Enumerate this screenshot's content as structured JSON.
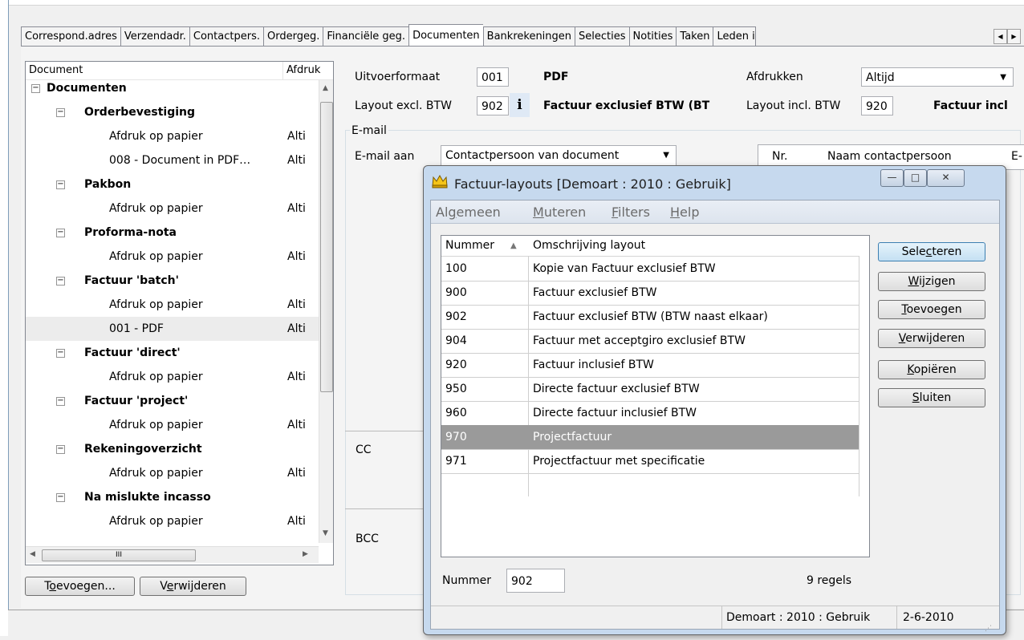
{
  "tabs": [
    "Correspond.adres",
    "Verzendadr.",
    "Contactpers.",
    "Ordergeg.",
    "Financiële geg.",
    "Documenten",
    "Bankrekeningen",
    "Selecties",
    "Notities",
    "Taken",
    "Leden ink"
  ],
  "tree": {
    "col_document": "Document",
    "col_afdruk": "Afdruk",
    "rows": [
      {
        "label": "Documenten",
        "afd": ""
      },
      {
        "label": "Orderbevestiging",
        "afd": ""
      },
      {
        "label": "Afdruk op papier",
        "afd": "Alti"
      },
      {
        "label": "008 - Document in PDF…",
        "afd": "Alti"
      },
      {
        "label": "Pakbon",
        "afd": ""
      },
      {
        "label": "Afdruk op papier",
        "afd": "Alti"
      },
      {
        "label": "Proforma-nota",
        "afd": ""
      },
      {
        "label": "Afdruk op papier",
        "afd": "Alti"
      },
      {
        "label": "Factuur 'batch'",
        "afd": ""
      },
      {
        "label": "Afdruk op papier",
        "afd": "Alti"
      },
      {
        "label": "001 - PDF",
        "afd": "Alti"
      },
      {
        "label": "Factuur 'direct'",
        "afd": ""
      },
      {
        "label": "Afdruk op papier",
        "afd": "Alti"
      },
      {
        "label": "Factuur 'project'",
        "afd": ""
      },
      {
        "label": "Afdruk op papier",
        "afd": "Alti"
      },
      {
        "label": "Rekeningoverzicht",
        "afd": ""
      },
      {
        "label": "Afdruk op papier",
        "afd": "Alti"
      },
      {
        "label": "Na mislukte incasso",
        "afd": ""
      },
      {
        "label": "Afdruk op papier",
        "afd": "Alti"
      }
    ],
    "hscroll_glyph": "III"
  },
  "buttons": {
    "toevoegen": {
      "pre": "T",
      "u": "o",
      "post": "evoegen..."
    },
    "verwijderen": {
      "pre": "V",
      "u": "e",
      "post": "rwijderen"
    }
  },
  "form": {
    "uitvoerformaat_label": "Uitvoerformaat",
    "uitvoerformaat_value": "001",
    "uitvoerformaat_desc": "PDF",
    "afdrukken_label": "Afdrukken",
    "afdrukken_value": "Altijd",
    "layout_excl_label": "Layout excl. BTW",
    "layout_excl_value": "902",
    "info_glyph": "i",
    "layout_excl_desc": "Factuur exclusief BTW (BT",
    "layout_incl_label": "Layout incl. BTW",
    "layout_incl_value": "920",
    "layout_incl_desc": "Factuur incl",
    "email_group": "E-mail",
    "email_aan_label": "E-mail aan",
    "email_aan_value": "Contactpersoon van document",
    "cc_label": "CC",
    "bcc_label": "BCC",
    "contact_col_nr": "Nr.",
    "contact_col_naam": "Naam contactpersoon",
    "contact_col_e": "E-"
  },
  "dialog": {
    "title": "Factuur-layouts  [Demoart : 2010 : Gebruik]",
    "menus": [
      {
        "pre": "Al",
        "u": "g",
        "post": "emeen"
      },
      {
        "pre": "",
        "u": "M",
        "post": "uteren"
      },
      {
        "pre": "",
        "u": "F",
        "post": "ilters"
      },
      {
        "pre": "",
        "u": "H",
        "post": "elp"
      }
    ],
    "col_nummer": "Nummer",
    "col_omschrijving": "Omschrijving layout",
    "rows": [
      {
        "nr": "100",
        "desc": "Kopie van Factuur exclusief BTW"
      },
      {
        "nr": "900",
        "desc": "Factuur exclusief BTW"
      },
      {
        "nr": "902",
        "desc": "Factuur exclusief BTW (BTW naast elkaar)"
      },
      {
        "nr": "904",
        "desc": "Factuur met acceptgiro exclusief BTW"
      },
      {
        "nr": "920",
        "desc": "Factuur inclusief BTW"
      },
      {
        "nr": "950",
        "desc": "Directe factuur exclusief BTW"
      },
      {
        "nr": "960",
        "desc": "Directe factuur inclusief BTW"
      },
      {
        "nr": "970",
        "desc": "Projectfactuur"
      },
      {
        "nr": "971",
        "desc": "Projectfactuur met specificatie"
      }
    ],
    "selected_row": "970",
    "action_buttons": [
      {
        "pre": "Sele",
        "u": "c",
        "post": "teren"
      },
      {
        "pre": "",
        "u": "W",
        "post": "ijzigen"
      },
      {
        "pre": "",
        "u": "T",
        "post": "oevoegen"
      },
      {
        "pre": "",
        "u": "V",
        "post": "erwijderen"
      },
      {
        "pre": "",
        "u": "K",
        "post": "opiëren"
      },
      {
        "pre": "",
        "u": "S",
        "post": "luiten"
      }
    ],
    "nummer_label": "Nummer",
    "nummer_value": "902",
    "regels": "9 regels",
    "status_context": "Demoart : 2010 : Gebruik",
    "status_date": "2-6-2010"
  }
}
